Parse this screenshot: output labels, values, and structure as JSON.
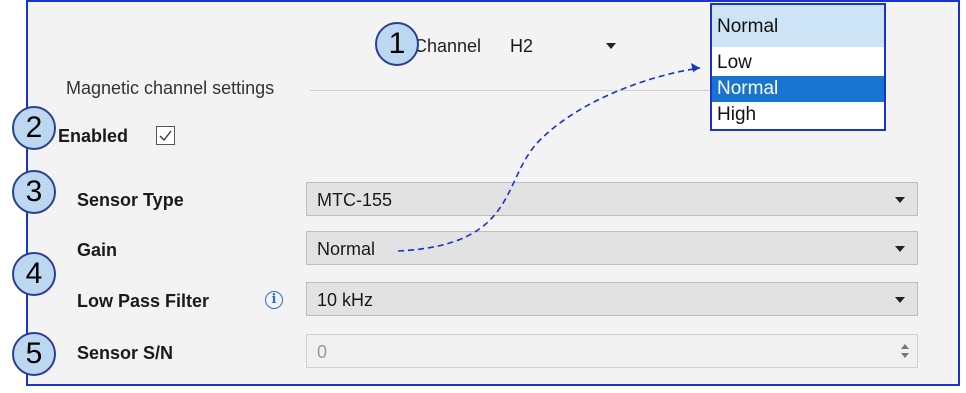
{
  "channel": {
    "label": "Channel",
    "value": "H2"
  },
  "group": {
    "title": "Magnetic channel settings"
  },
  "enabled": {
    "label": "Enabled",
    "checked": true
  },
  "fields": {
    "sensor_type": {
      "label": "Sensor Type",
      "value": "MTC-155"
    },
    "gain": {
      "label": "Gain",
      "value": "Normal"
    },
    "low_pass": {
      "label": "Low Pass Filter",
      "value": "10 kHz"
    },
    "sensor_sn": {
      "label": "Sensor S/N",
      "value": "0"
    }
  },
  "callouts": [
    "1",
    "2",
    "3",
    "4",
    "5"
  ],
  "gain_dropdown": {
    "current": "Normal",
    "options": [
      "Low",
      "Normal",
      "High"
    ],
    "selected_index": 1
  },
  "colors": {
    "accent_border": "#1a33c9",
    "selection": "#1874d0",
    "callout_fill": "#bcd8f1"
  },
  "icons": {
    "info": "info-icon",
    "dropdown_arrow": "chevron-down-icon",
    "spin": "spinbox-arrows-icon"
  }
}
